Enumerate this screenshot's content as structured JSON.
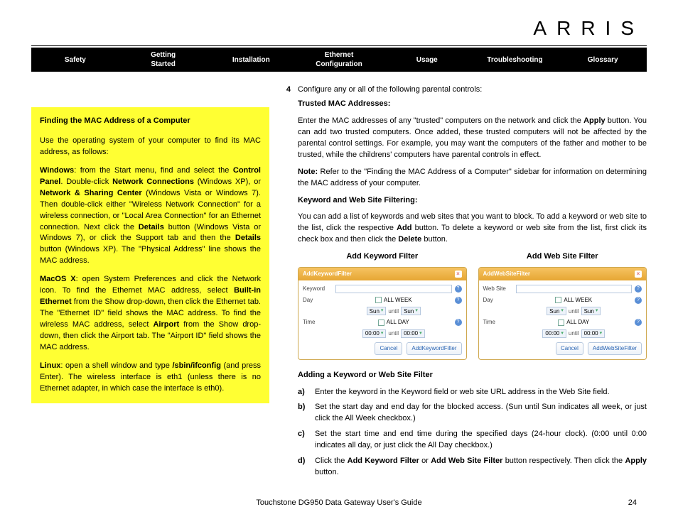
{
  "brand": "ARRIS",
  "nav": [
    "Safety",
    "Getting\nStarted",
    "Installation",
    "Ethernet\nConfiguration",
    "Usage",
    "Troubleshooting",
    "Glossary"
  ],
  "sidebar": {
    "title": "Finding the MAC Address of a Computer",
    "intro": "Use the operating system of your computer to find its MAC address, as follows:",
    "win_lead": "Windows",
    "win_body_a": ": from the Start menu, find and select the ",
    "win_cp": "Control Panel",
    "win_body_b": ". Double-click ",
    "win_nc": "Network Connections",
    "win_body_c": " (Windows XP), or ",
    "win_nsc": "Network & Sharing Center",
    "win_body_d": " (Windows Vista or Windows 7). Then double-click either \"Wireless Network Connection\" for a wireless connection, or \"Local Area Connection\" for an Ethernet connection. Next click the ",
    "win_det": "Details",
    "win_body_e": " button (Windows Vista or Windows 7), or click the Support tab and then the ",
    "win_det2": "Details",
    "win_body_f": " button (Windows XP). The \"Physical Address\" line shows the MAC address.",
    "mac_lead": "MacOS X",
    "mac_body_a": ": open System Preferences and click the Network icon. To find the Ethernet MAC address, select ",
    "mac_be": "Built-in Ethernet",
    "mac_body_b": " from the Show drop-down, then click the Ethernet tab. The \"Ethernet ID\" field shows the MAC address. To find the wireless MAC address, select ",
    "mac_air": "Airport",
    "mac_body_c": " from the Show drop-down, then click the Airport tab. The \"Airport ID\" field shows the MAC address.",
    "lin_lead": "Linux",
    "lin_body_a": ": open a shell window and type ",
    "lin_cmd": "/sbin/ifconfig",
    "lin_body_b": " (and press Enter). The wireless interface is eth1 (unless there is no Ethernet adapter, in which case the interface is eth0)."
  },
  "main": {
    "step_num": "4",
    "step_text": "Configure any or all of the following parental controls:",
    "tma_title": "Trusted MAC Addresses:",
    "tma_p1a": "Enter the MAC addresses of any \"trusted\" computers on the network and click the ",
    "tma_apply": "Apply",
    "tma_p1b": " button. You can add two trusted computers. Once added, these trusted computers will not be affected by the parental control settings. For example, you may want the computers of the father and mother to be trusted, while the childrens' computers have parental controls in effect.",
    "tma_note_lead": "Note:",
    "tma_note": " Refer to the \"Finding the MAC Address of a Computer\" sidebar for information on determining the MAC address of your computer.",
    "kw_title": "Keyword and Web Site Filtering:",
    "kw_p1a": "You can add a list of keywords and web sites that you want to block. To add a keyword or web site to the list, click the respective ",
    "kw_add": "Add",
    "kw_p1b": " button. To delete a keyword or web site from the list, first click its check box and then click the ",
    "kw_del": "Delete",
    "kw_p1c": " button.",
    "cap_keyword": "Add Keyword Filter",
    "cap_website": "Add Web Site Filter",
    "add_title": "Adding a Keyword or Web Site Filter",
    "li_a": "Enter the keyword in the Keyword field or web site URL address in the Web Site field.",
    "li_b": "Set the start day and end day for the blocked access. (Sun until Sun indicates all week, or just click the All Week checkbox.)",
    "li_c": "Set the start time and end time during the specified days (24-hour clock). (0:00 until 0:00 indicates all day, or just click the All Day checkbox.)",
    "li_d_a": "Click the ",
    "li_d_akf": "Add Keyword Filter",
    "li_d_b": " or ",
    "li_d_awf": "Add Web Site Filter",
    "li_d_c": " button respectively. Then click the ",
    "li_d_apply": "Apply",
    "li_d_d": " button."
  },
  "dialogs": {
    "kw": {
      "title": "AddKeywordFilter",
      "f1": "Keyword",
      "btn": "AddKeywordFilter"
    },
    "ws": {
      "title": "AddWebSiteFilter",
      "f1": "Web Site",
      "btn": "AddWebSiteFilter"
    },
    "day": "Day",
    "time": "Time",
    "allweek": "ALL WEEK",
    "allday": "ALL DAY",
    "sun": "Sun",
    "until": "until",
    "t": "00:00",
    "cancel": "Cancel",
    "q": "?"
  },
  "footer": {
    "title": "Touchstone DG950 Data Gateway User's Guide",
    "page": "24"
  }
}
